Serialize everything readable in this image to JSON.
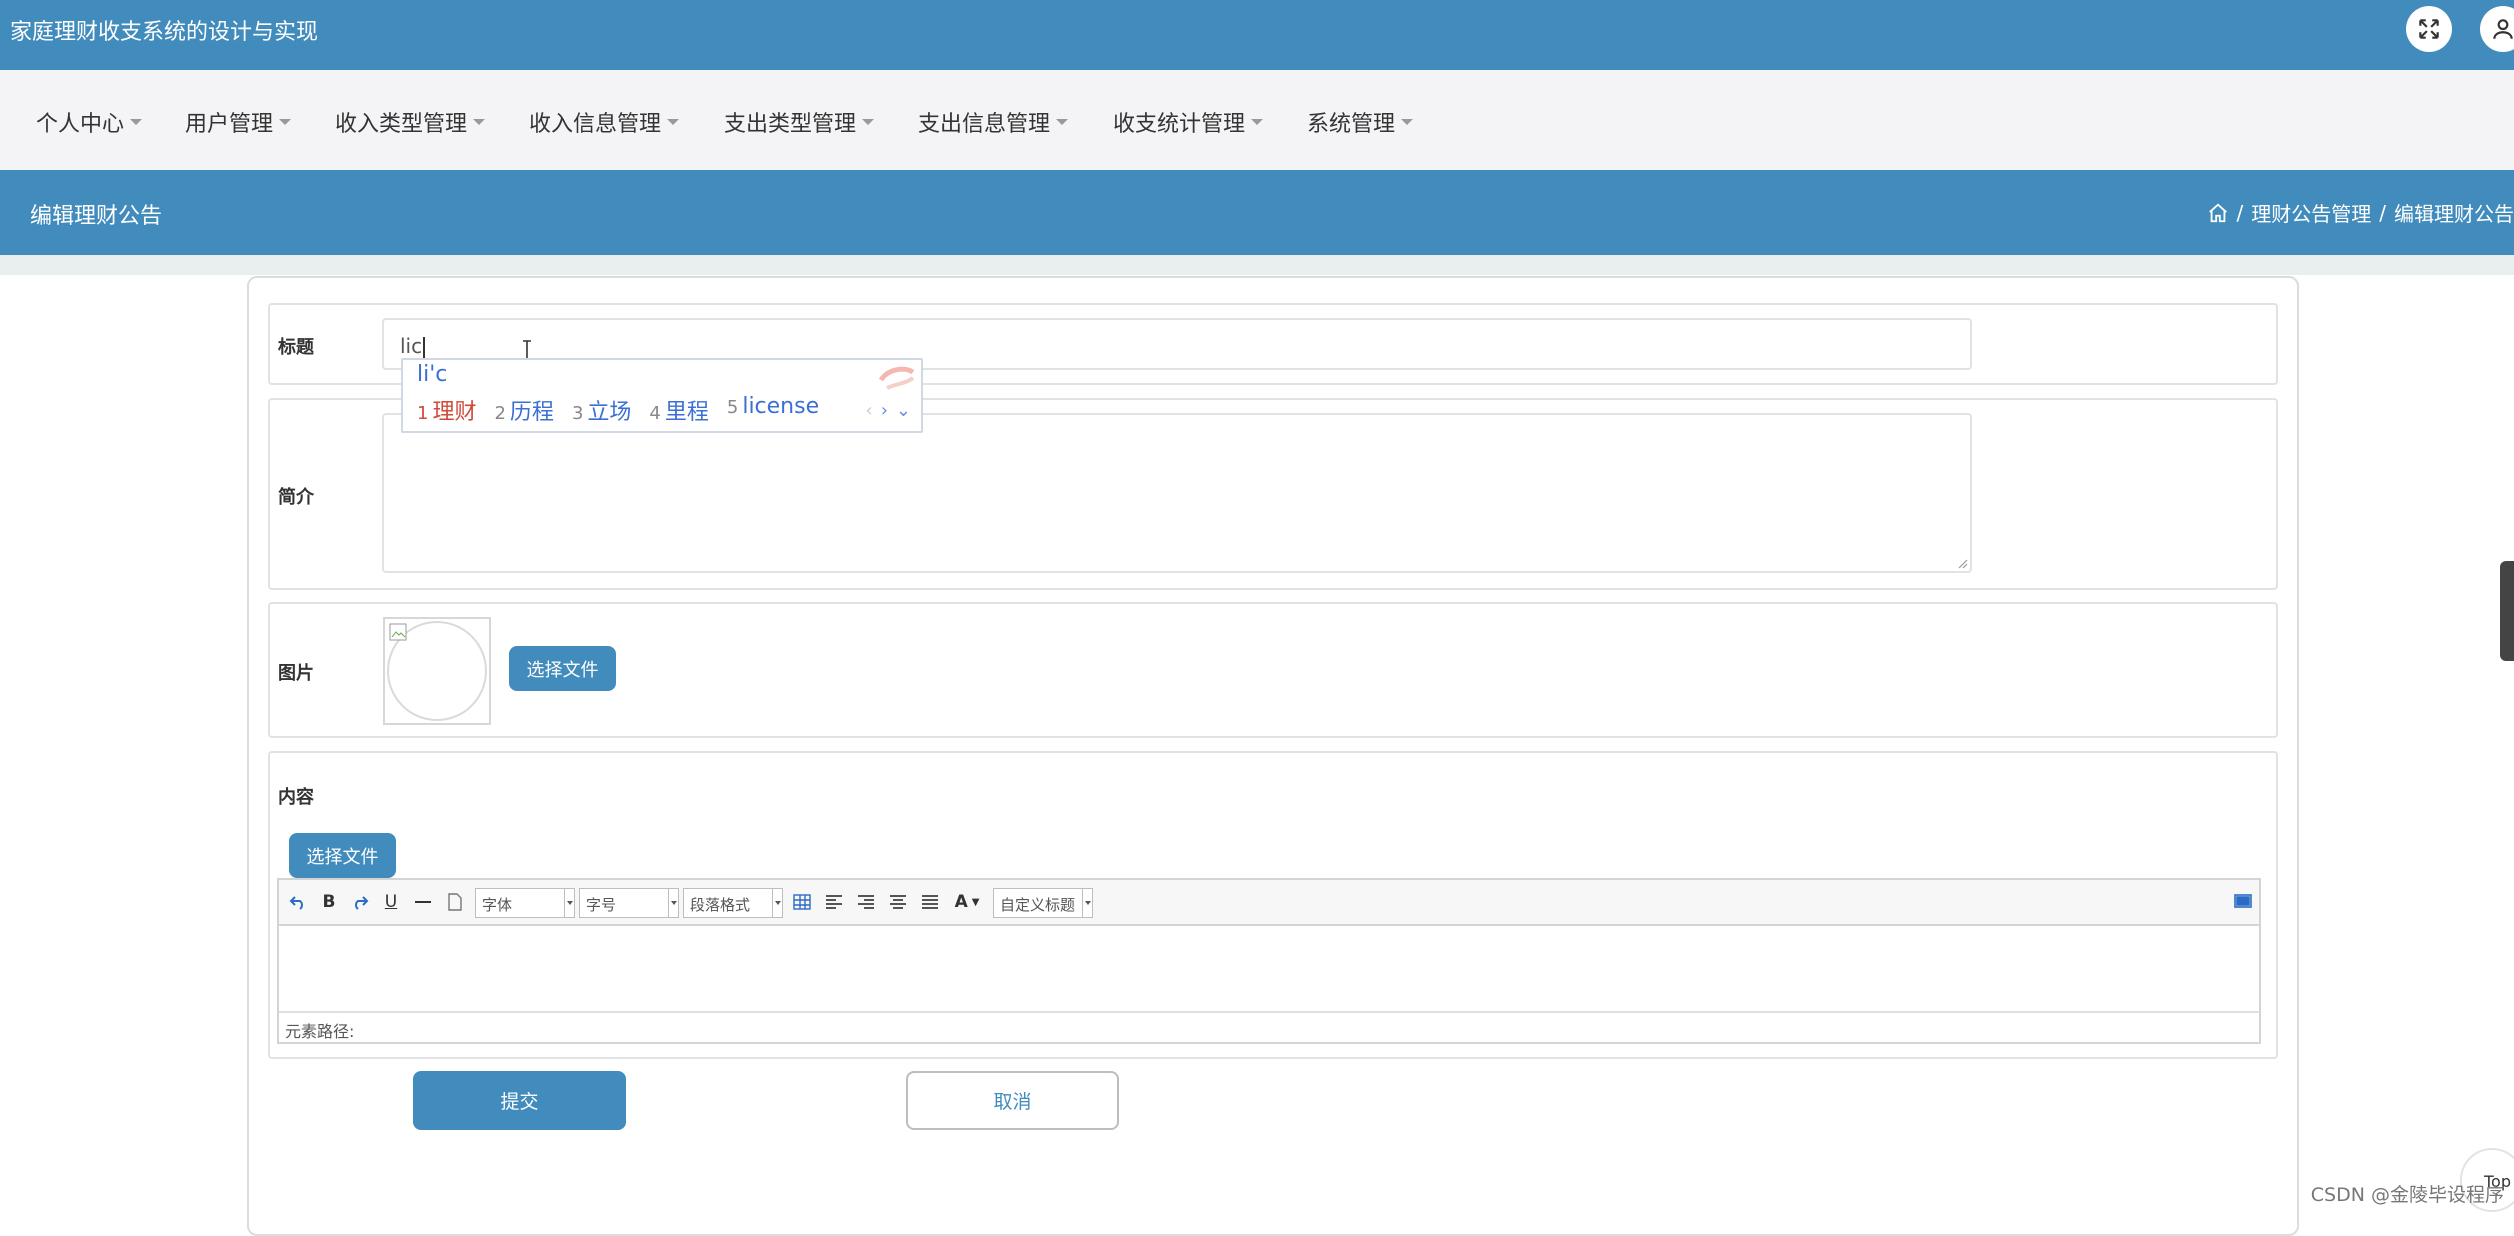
{
  "app": {
    "title": "家庭理财收支系统的设计与实现"
  },
  "nav": {
    "items": [
      {
        "label": "个人中心"
      },
      {
        "label": "用户管理"
      },
      {
        "label": "收入类型管理"
      },
      {
        "label": "收入信息管理"
      },
      {
        "label": "支出类型管理"
      },
      {
        "label": "支出信息管理"
      },
      {
        "label": "收支统计管理"
      },
      {
        "label": "系统管理"
      }
    ]
  },
  "page": {
    "title": "编辑理财公告",
    "breadcrumb": [
      "理财公告管理",
      "编辑理财公告"
    ],
    "breadcrumb_sep": "/"
  },
  "form": {
    "title_label": "标题",
    "title_value": "lic",
    "intro_label": "简介",
    "intro_value": "",
    "image_label": "图片",
    "image_button": "选择文件",
    "content_label": "内容",
    "content_button": "选择文件",
    "submit_label": "提交",
    "cancel_label": "取消"
  },
  "ime": {
    "composition": "li'c",
    "candidates": [
      {
        "num": "1",
        "word": "理财"
      },
      {
        "num": "2",
        "word": "历程"
      },
      {
        "num": "3",
        "word": "立场"
      },
      {
        "num": "4",
        "word": "里程"
      },
      {
        "num": "5",
        "word": "license"
      }
    ]
  },
  "editor": {
    "font_family": "字体",
    "font_size": "字号",
    "paragraph": "段落格式",
    "custom_title": "自定义标题",
    "bold": "B",
    "underline": "U",
    "font_color": "A",
    "status_path": "元素路径:"
  },
  "footer": {
    "top_label": "Top",
    "watermark": "CSDN @金陵毕设程序"
  },
  "colors": {
    "primary": "#428cbd",
    "nav_bg": "#f4f3f6"
  },
  "icons": {
    "fullscreen": "fullscreen-icon",
    "user": "user-icon",
    "home": "home-icon"
  }
}
